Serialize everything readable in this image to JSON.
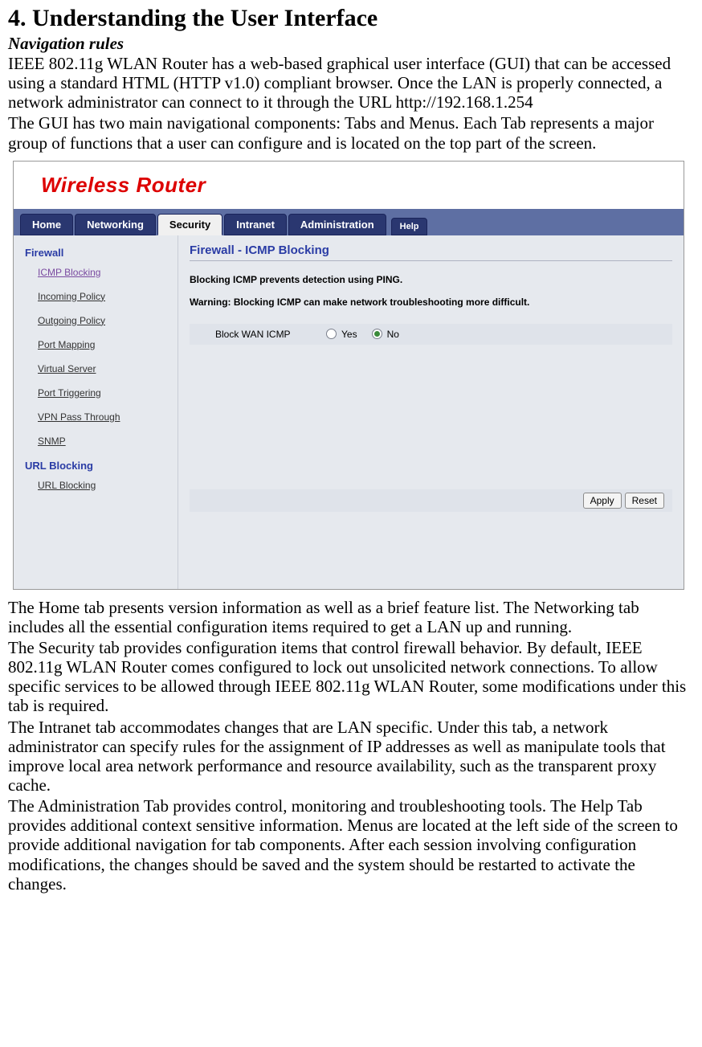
{
  "doc": {
    "heading": "4. Understanding the User Interface",
    "subheading": "Navigation rules",
    "intro_p1": "IEEE 802.11g WLAN Router has a web-based graphical user interface (GUI) that can be accessed using a standard HTML (HTTP v1.0) compliant browser. Once the LAN is properly connected, a network administrator can connect to it through the URL http://192.168.1.254",
    "intro_p2": "The GUI has two main navigational components: Tabs and Menus. Each Tab represents a major group of functions that a user can configure and is located on the top part of the screen.",
    "after_p1": "The Home tab presents version information as well as a brief feature list. The Networking tab includes all the essential configuration items required to get a LAN up and running.",
    "after_p2": "The Security tab provides configuration items that control firewall behavior. By default, IEEE 802.11g WLAN Router comes configured to lock out unsolicited network connections. To allow specific services to be allowed through IEEE 802.11g WLAN Router, some modifications under this tab is required.",
    "after_p3": "The Intranet tab accommodates changes that are LAN specific. Under this tab, a network administrator can specify rules for the assignment of IP addresses as well as manipulate tools that improve local area network performance and resource availability, such as the transparent proxy cache.",
    "after_p4": "The Administration Tab provides control, monitoring and troubleshooting tools. The Help Tab provides additional context sensitive information. Menus are located at the left side of the screen to provide additional navigation for tab components. After each session involving configuration modifications, the changes should be saved and the system should be restarted to activate the changes."
  },
  "ui": {
    "logo": "Wireless Router",
    "tabs": {
      "home": "Home",
      "networking": "Networking",
      "security": "Security",
      "intranet": "Intranet",
      "administration": "Administration",
      "help": "Help"
    },
    "active_tab": "security",
    "sidebar": {
      "group1": {
        "heading": "Firewall",
        "items": [
          "ICMP Blocking",
          "Incoming Policy",
          "Outgoing Policy",
          "Port Mapping",
          "Virtual Server",
          "Port Triggering",
          "VPN Pass Through",
          "SNMP"
        ],
        "active_index": 0
      },
      "group2": {
        "heading": "URL Blocking",
        "items": [
          "URL Blocking"
        ]
      }
    },
    "main": {
      "title": "Firewall - ICMP Blocking",
      "desc": "Blocking ICMP prevents detection using PING.",
      "warning": "Warning: Blocking ICMP can make network troubleshooting more difficult.",
      "field_label": "Block WAN ICMP",
      "options": {
        "yes": "Yes",
        "no": "No"
      },
      "selected": "no",
      "buttons": {
        "apply": "Apply",
        "reset": "Reset"
      }
    }
  }
}
